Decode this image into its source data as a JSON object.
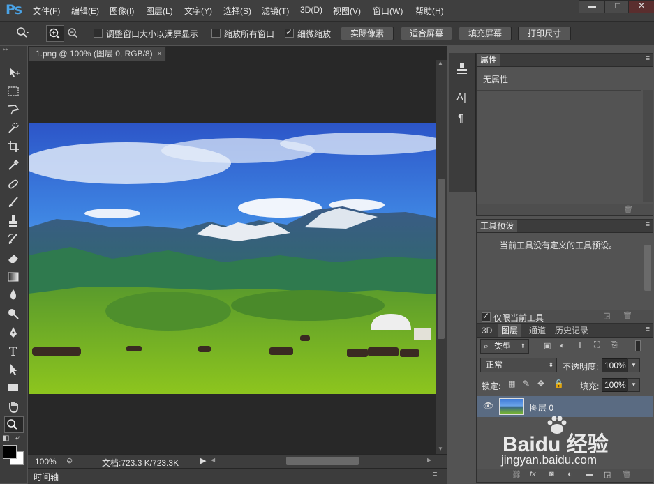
{
  "app": {
    "logo": "Ps"
  },
  "menu": [
    "文件(F)",
    "编辑(E)",
    "图像(I)",
    "图层(L)",
    "文字(Y)",
    "选择(S)",
    "滤镜(T)",
    "3D(D)",
    "视图(V)",
    "窗口(W)",
    "帮助(H)"
  ],
  "window_controls": {
    "minimize": "▬",
    "maximize": "□",
    "close": "✕"
  },
  "options": {
    "fit_window": "调整窗口大小以满屏显示",
    "zoom_all": "缩放所有窗口",
    "scrubby_zoom": "细微缩放",
    "btn_actual": "实际像素",
    "btn_fit": "适合屏幕",
    "btn_fill": "填充屏幕",
    "btn_print": "打印尺寸"
  },
  "document": {
    "tab_title": "1.png @ 100% (图层 0, RGB/8)",
    "zoom": "100%",
    "doc_size": "文档:723.3 K/723.3K"
  },
  "timeline": {
    "label": "时间轴"
  },
  "properties": {
    "title": "属性",
    "empty_text": "无属性"
  },
  "tool_presets": {
    "title": "工具预设",
    "empty_text": "当前工具没有定义的工具预设。",
    "only_current": "仅限当前工具"
  },
  "layers_panel": {
    "tabs": [
      "3D",
      "图层",
      "通道",
      "历史记录"
    ],
    "filter_label": "类型",
    "blend_mode": "正常",
    "opacity_label": "不透明度:",
    "opacity_value": "100%",
    "lock_label": "锁定:",
    "fill_label": "填充:",
    "fill_value": "100%",
    "layers": [
      {
        "name": "图层 0"
      }
    ]
  },
  "watermark": {
    "brand": "Baidu 经验",
    "url": "jingyan.baidu.com"
  },
  "colors": {
    "accent": "#4aa3e6",
    "selected_layer": "#5a6b82"
  }
}
